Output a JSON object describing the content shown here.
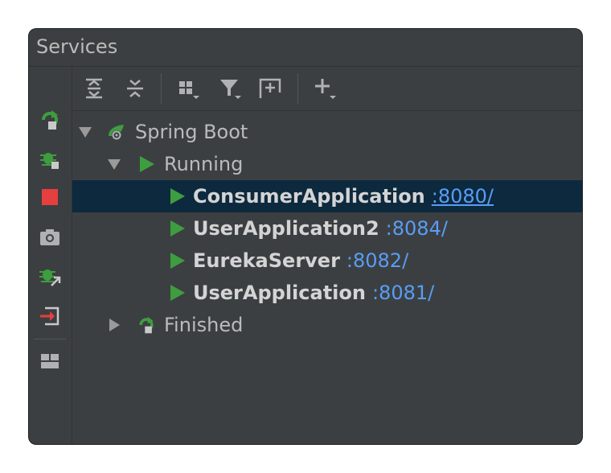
{
  "window": {
    "title": "Services"
  },
  "left_toolbar": {
    "items": [
      {
        "icon": "rerun-icon"
      },
      {
        "icon": "debug-icon"
      },
      {
        "icon": "stop-icon"
      },
      {
        "icon": "camera-icon"
      },
      {
        "icon": "attach-debugger-icon"
      },
      {
        "icon": "exit-icon"
      },
      {
        "icon": "layout-icon"
      }
    ]
  },
  "top_toolbar": {
    "items": [
      {
        "icon": "expand-all-icon"
      },
      {
        "icon": "collapse-all-icon"
      },
      {
        "icon": "group-by-icon"
      },
      {
        "icon": "filter-icon"
      },
      {
        "icon": "new-tab-icon"
      },
      {
        "icon": "add-icon"
      }
    ]
  },
  "tree": {
    "root": {
      "label": "Spring Boot",
      "expanded": true
    },
    "running": {
      "label": "Running",
      "expanded": true
    },
    "apps": [
      {
        "name": "ConsumerApplication",
        "port": ":8080/",
        "selected": true
      },
      {
        "name": "UserApplication2",
        "port": ":8084/",
        "selected": false
      },
      {
        "name": "EurekaServer",
        "port": ":8082/",
        "selected": false
      },
      {
        "name": "UserApplication",
        "port": ":8081/",
        "selected": false
      }
    ],
    "finished": {
      "label": "Finished",
      "expanded": false
    }
  },
  "colors": {
    "green": "#3e9e3f",
    "link": "#589df6",
    "stop_red": "#e5403e",
    "selection": "#0d293e"
  }
}
